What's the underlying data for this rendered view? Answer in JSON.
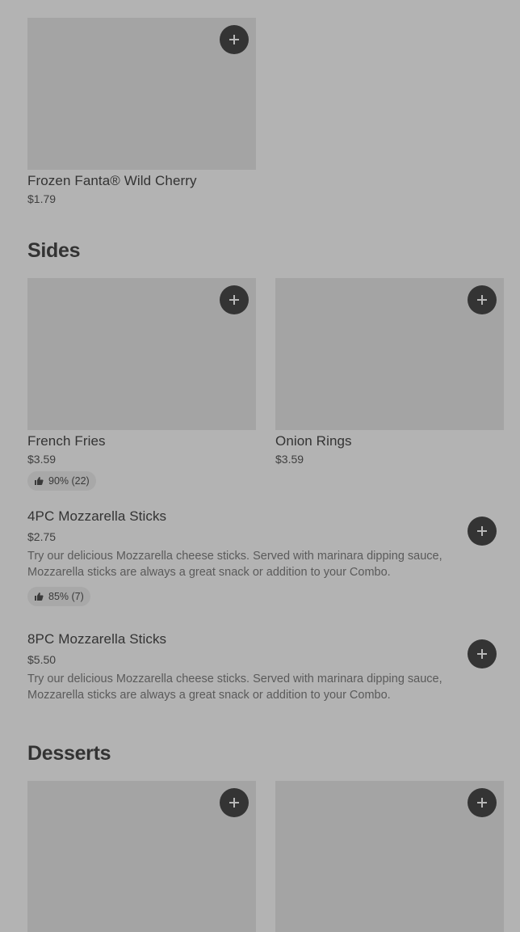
{
  "colors": {
    "overlay_background": "#b3b3b3",
    "image_placeholder": "#a4a4a4",
    "button_background": "#343434",
    "rating_pill": "#a8a8a8"
  },
  "icons": {
    "add": "plus-icon",
    "rating": "thumbs-up-icon"
  },
  "beverages": {
    "items": [
      {
        "name": "Frozen Fanta® Wild Cherry",
        "price": "$1.79"
      }
    ]
  },
  "sides": {
    "title": "Sides",
    "grid_items": [
      {
        "name": "French Fries",
        "price": "$3.59",
        "rating": "90% (22)"
      },
      {
        "name": "Onion Rings",
        "price": "$3.59"
      }
    ],
    "list_items": [
      {
        "name": "4PC Mozzarella Sticks",
        "price": "$2.75",
        "description": "Try our delicious Mozzarella cheese sticks. Served with marinara dipping sauce, Mozzarella sticks are always a great snack or addition to your Combo.",
        "rating": "85% (7)"
      },
      {
        "name": "8PC Mozzarella Sticks",
        "price": "$5.50",
        "description": "Try our delicious Mozzarella cheese sticks. Served with marinara dipping sauce, Mozzarella sticks are always a great snack or addition to your Combo."
      }
    ]
  },
  "desserts": {
    "title": "Desserts"
  }
}
